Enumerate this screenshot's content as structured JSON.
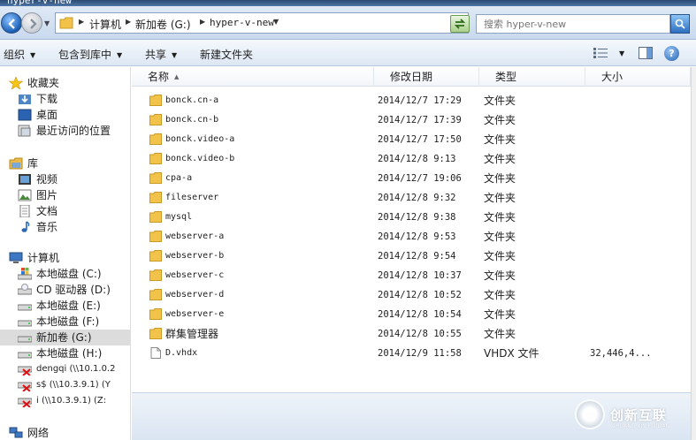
{
  "window": {
    "title": "hyper-v-new"
  },
  "address": {
    "crumbs": [
      "计算机",
      "新加卷 (G:)",
      "hyper-v-new"
    ]
  },
  "search": {
    "placeholder": "搜索 hyper-v-new"
  },
  "toolbar": {
    "organize": "组织",
    "include_library": "包含到库中",
    "share": "共享",
    "new_folder": "新建文件夹"
  },
  "sidebar": {
    "favorites": {
      "label": "收藏夹",
      "items": [
        "下载",
        "桌面",
        "最近访问的位置"
      ]
    },
    "libraries": {
      "label": "库",
      "items": [
        "视频",
        "图片",
        "文档",
        "音乐"
      ]
    },
    "computer": {
      "label": "计算机",
      "items": [
        "本地磁盘 (C:)",
        "CD 驱动器 (D:)",
        "本地磁盘 (E:)",
        "本地磁盘 (F:)",
        "新加卷 (G:)",
        "本地磁盘 (H:)",
        "dengqi (\\\\10.1.0.2",
        "s$ (\\\\10.3.9.1) (Y",
        "i (\\\\10.3.9.1) (Z:"
      ]
    },
    "network": {
      "label": "网络"
    }
  },
  "columns": {
    "name": "名称",
    "date": "修改日期",
    "type": "类型",
    "size": "大小"
  },
  "files": [
    {
      "name": "bonck.cn-a",
      "date": "2014/12/7 17:29",
      "type": "文件夹",
      "size": ""
    },
    {
      "name": "bonck.cn-b",
      "date": "2014/12/7 17:39",
      "type": "文件夹",
      "size": ""
    },
    {
      "name": "bonck.video-a",
      "date": "2014/12/7 17:50",
      "type": "文件夹",
      "size": ""
    },
    {
      "name": "bonck.video-b",
      "date": "2014/12/8 9:13",
      "type": "文件夹",
      "size": ""
    },
    {
      "name": "cpa-a",
      "date": "2014/12/7 19:06",
      "type": "文件夹",
      "size": ""
    },
    {
      "name": "fileserver",
      "date": "2014/12/8 9:32",
      "type": "文件夹",
      "size": ""
    },
    {
      "name": "mysql",
      "date": "2014/12/8 9:38",
      "type": "文件夹",
      "size": ""
    },
    {
      "name": "webserver-a",
      "date": "2014/12/8 9:53",
      "type": "文件夹",
      "size": ""
    },
    {
      "name": "webserver-b",
      "date": "2014/12/8 9:54",
      "type": "文件夹",
      "size": ""
    },
    {
      "name": "webserver-c",
      "date": "2014/12/8 10:37",
      "type": "文件夹",
      "size": ""
    },
    {
      "name": "webserver-d",
      "date": "2014/12/8 10:52",
      "type": "文件夹",
      "size": ""
    },
    {
      "name": "webserver-e",
      "date": "2014/12/8 10:54",
      "type": "文件夹",
      "size": ""
    },
    {
      "name": "群集管理器",
      "date": "2014/12/8 10:55",
      "type": "文件夹",
      "size": ""
    },
    {
      "name": "D.vhdx",
      "date": "2014/12/9 11:58",
      "type": "VHDX 文件",
      "size": "32,446,4..."
    }
  ],
  "watermark": {
    "text": "创新互联",
    "sub": "CHUANG XIN HU LIAN"
  },
  "colors": {
    "folder": "#f2c34b",
    "accent": "#2d6fc0",
    "selected": "#dcdcdc"
  }
}
